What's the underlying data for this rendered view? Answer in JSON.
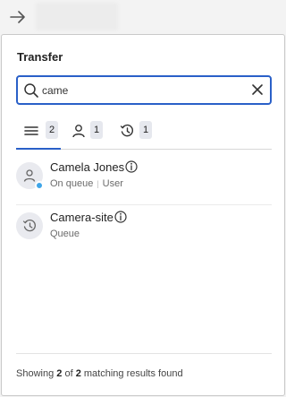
{
  "panel": {
    "title": "Transfer"
  },
  "search": {
    "value": "came",
    "placeholder": ""
  },
  "tabs": [
    {
      "name": "all",
      "icon": "list-icon",
      "count": "2",
      "active": true
    },
    {
      "name": "users",
      "icon": "person-icon",
      "count": "1",
      "active": false
    },
    {
      "name": "queues",
      "icon": "clock-history-icon",
      "count": "1",
      "active": false
    }
  ],
  "results": [
    {
      "name": "Camela Jones",
      "status": "On queue",
      "type": "User",
      "icon": "person-icon",
      "presence_color": "#3fa5e8"
    },
    {
      "name": "Camera-site",
      "type": "Queue",
      "icon": "clock-history-icon"
    }
  ],
  "footer": {
    "prefix": "Showing",
    "shown": "2",
    "of": "of",
    "total": "2",
    "suffix": "matching results found"
  },
  "colors": {
    "accent": "#2a60c8",
    "presence": "#3fa5e8"
  }
}
